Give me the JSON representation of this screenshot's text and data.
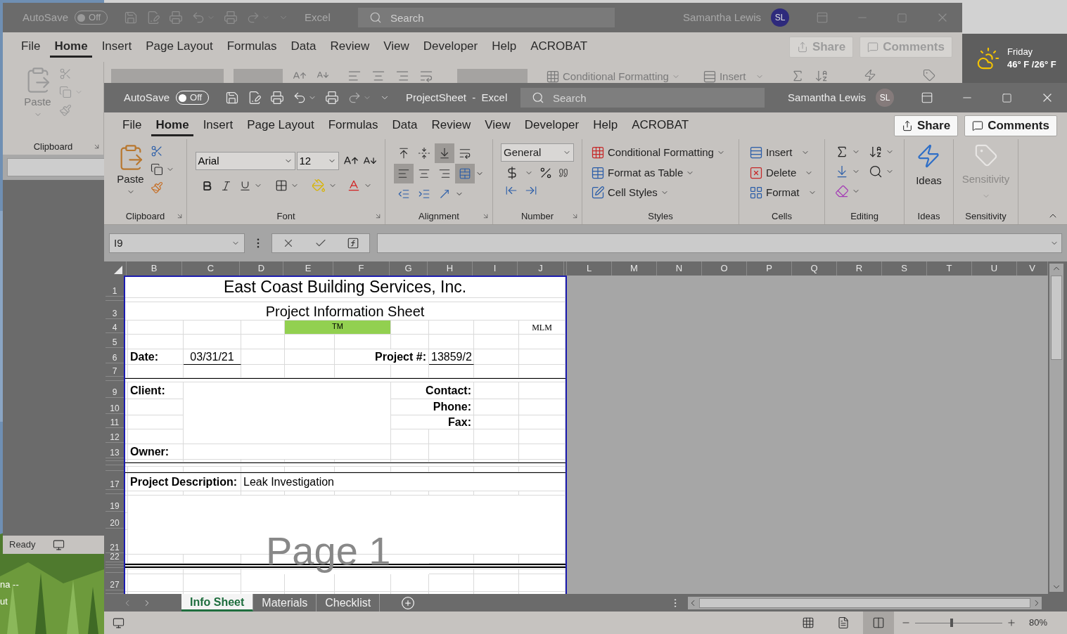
{
  "desktop": {
    "labels": [
      "na --",
      "ut"
    ]
  },
  "weather": {
    "day": "Friday",
    "temperature": "46° F /26° F"
  },
  "back_window": {
    "autosave": {
      "label": "AutoSave",
      "on": false,
      "state": "Off"
    },
    "title": "Excel",
    "search": {
      "placeholder": "Search"
    },
    "user": {
      "name": "Samantha Lewis",
      "initials": "SL"
    },
    "tabs": [
      {
        "label": "File",
        "selected": false
      },
      {
        "label": "Home",
        "selected": true
      },
      {
        "label": "Insert",
        "selected": false
      },
      {
        "label": "Page Layout",
        "selected": false
      },
      {
        "label": "Formulas",
        "selected": false
      },
      {
        "label": "Data",
        "selected": false
      },
      {
        "label": "Review",
        "selected": false
      },
      {
        "label": "View",
        "selected": false
      },
      {
        "label": "Developer",
        "selected": false
      },
      {
        "label": "Help",
        "selected": false
      },
      {
        "label": "ACROBAT",
        "selected": false
      }
    ],
    "share": "Share",
    "comments": "Comments",
    "ribbon": {
      "paste": "Paste",
      "clipboard": "Clipboard",
      "conditional_formatting": "Conditional Formatting",
      "insert": "Insert"
    },
    "status_bar": {
      "status": "Ready"
    }
  },
  "window": {
    "autosave": {
      "label": "AutoSave",
      "on": false,
      "state": "Off"
    },
    "title": "ProjectSheet  -  Excel",
    "search": {
      "placeholder": "Search"
    },
    "user": {
      "name": "Samantha Lewis",
      "initials": "SL"
    },
    "tabs": [
      {
        "label": "File",
        "selected": false
      },
      {
        "label": "Home",
        "selected": true
      },
      {
        "label": "Insert",
        "selected": false
      },
      {
        "label": "Page Layout",
        "selected": false
      },
      {
        "label": "Formulas",
        "selected": false
      },
      {
        "label": "Data",
        "selected": false
      },
      {
        "label": "Review",
        "selected": false
      },
      {
        "label": "View",
        "selected": false
      },
      {
        "label": "Developer",
        "selected": false
      },
      {
        "label": "Help",
        "selected": false
      },
      {
        "label": "ACROBAT",
        "selected": false
      }
    ],
    "share": "Share",
    "comments": "Comments",
    "ribbon": {
      "clipboard": {
        "paste": "Paste",
        "label": "Clipboard"
      },
      "font": {
        "name": "Arial",
        "size": "12",
        "label": "Font"
      },
      "alignment": {
        "label": "Alignment",
        "buttons": [
          {
            "kind": "align-top",
            "selected": false
          },
          {
            "kind": "align-middle",
            "selected": false
          },
          {
            "kind": "align-bottom",
            "selected": true
          },
          {
            "kind": "wrap",
            "selected": false
          },
          {
            "kind": "align-left",
            "selected": true
          },
          {
            "kind": "align-center",
            "selected": false
          },
          {
            "kind": "align-right",
            "selected": false
          },
          {
            "kind": "merge",
            "selected": true
          },
          {
            "kind": "outdent",
            "selected": false
          },
          {
            "kind": "indent",
            "selected": false
          },
          {
            "kind": "orientation",
            "selected": false
          }
        ]
      },
      "number": {
        "format": "General",
        "label": "Number"
      },
      "styles": {
        "items": [
          "Conditional Formatting",
          "Format as Table",
          "Cell Styles"
        ],
        "label": "Styles"
      },
      "cells": {
        "items": [
          "Insert",
          "Delete",
          "Format"
        ],
        "label": "Cells"
      },
      "editing": {
        "label": "Editing"
      },
      "ideas": {
        "button": "Ideas",
        "label": "Ideas"
      },
      "sensitivity": {
        "button": "Sensitivity",
        "disabled": true,
        "label": "Sensitivity"
      }
    },
    "formula_bar": {
      "name_box": "I9"
    },
    "sheet": {
      "columns": [
        "B",
        "C",
        "D",
        "E",
        "F",
        "G",
        "H",
        "I",
        "J",
        "L",
        "M",
        "N",
        "O",
        "P",
        "Q",
        "R",
        "S",
        "T",
        "U",
        "V"
      ],
      "rows": [
        "1",
        "3",
        "4",
        "5",
        "6",
        "7",
        "9",
        "10",
        "11",
        "12",
        "13",
        "17",
        "19",
        "20",
        "21",
        "22",
        "27"
      ],
      "cells": {
        "title": "East Coast Building Services, Inc.",
        "subtitle": "Project Information Sheet",
        "tm": "TM",
        "initials": "MLM",
        "date_label": "Date:",
        "date_value": "03/31/21",
        "project_label": "Project #:",
        "project_value": "13859/2",
        "client_label": "Client:",
        "contact_label": "Contact:",
        "phone_label": "Phone:",
        "fax_label": "Fax:",
        "owner_label": "Owner:",
        "description_label": "Project Description:",
        "description_value": "Leak Investigation"
      },
      "page_label": "Page 1"
    },
    "sheet_tabs": [
      {
        "label": "Info Sheet",
        "selected": true
      },
      {
        "label": "Materials",
        "selected": false
      },
      {
        "label": "Checklist",
        "selected": false
      }
    ],
    "status_bar": {
      "views": [
        {
          "kind": "normal",
          "selected": false
        },
        {
          "kind": "page-layout",
          "selected": false
        },
        {
          "kind": "page-break",
          "selected": true
        }
      ],
      "zoom": {
        "level": 0.4,
        "reading": "80%"
      }
    }
  }
}
